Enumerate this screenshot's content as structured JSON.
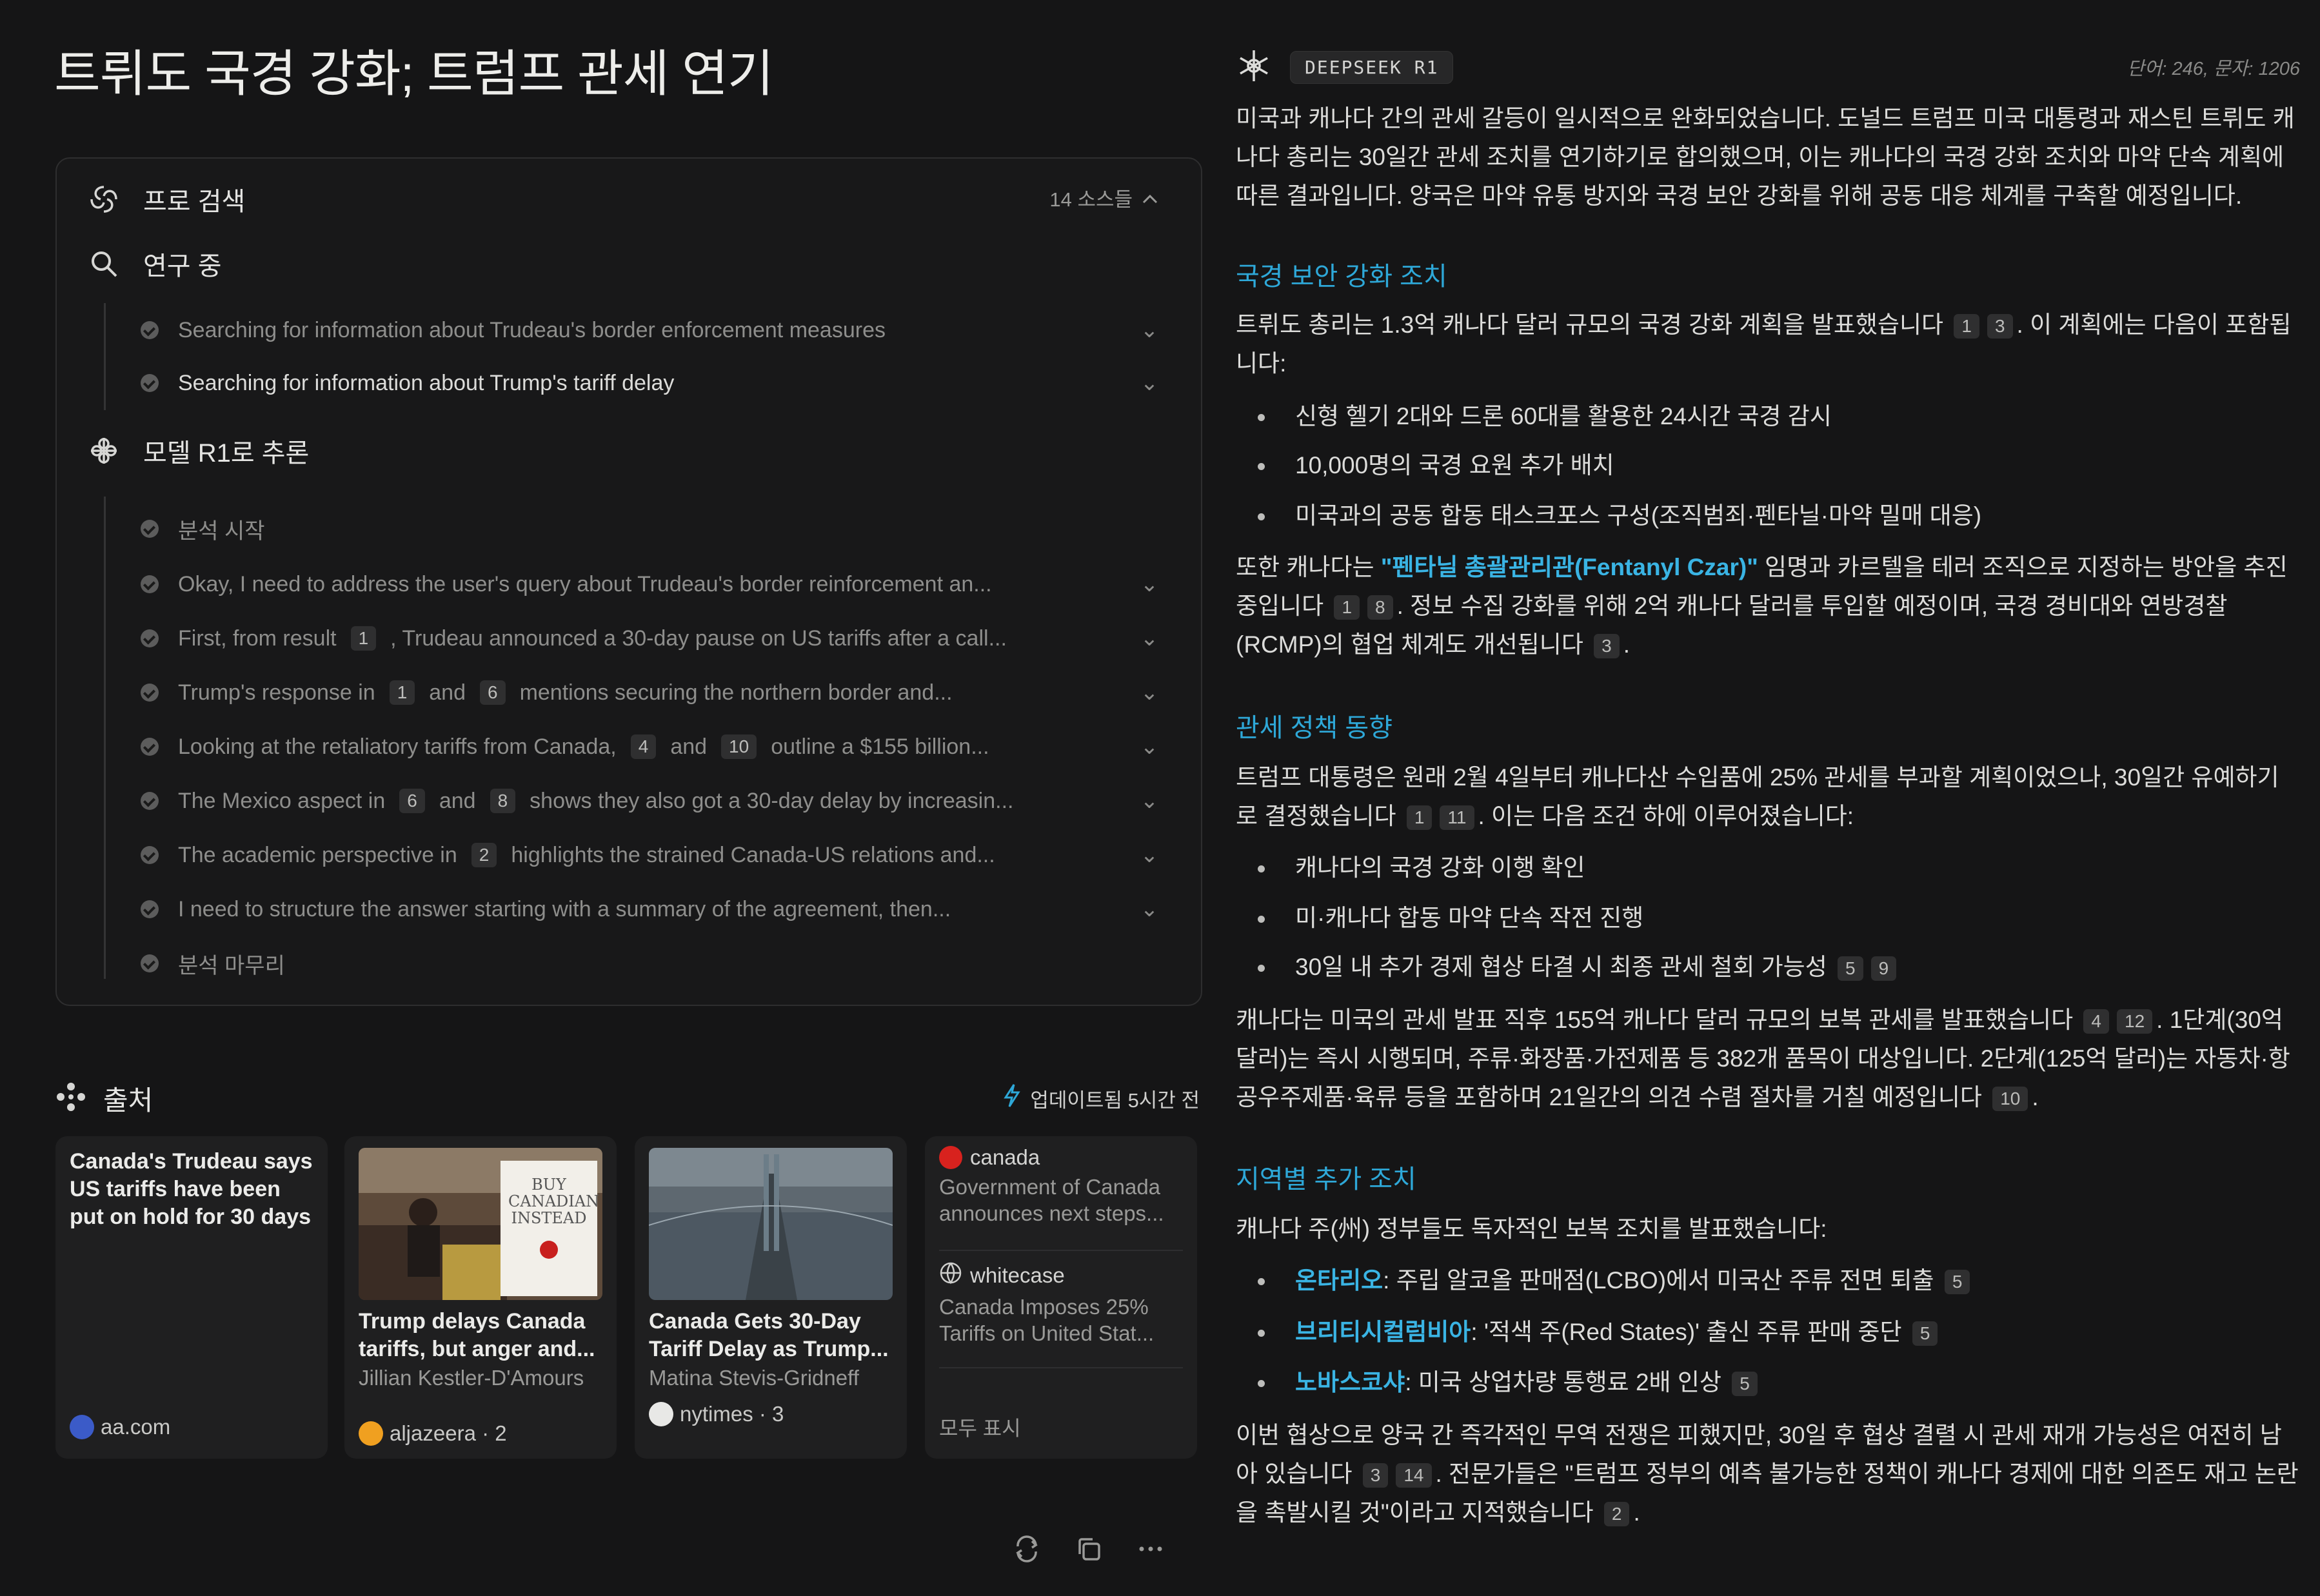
{
  "title": "트뤼도 국경 강화; 트럼프 관세 연기",
  "search": {
    "pro_label": "프로 검색",
    "source_count": "14 소스들",
    "research_label": "연구 중",
    "research_steps": [
      "Searching for information about Trudeau's border enforcement measures",
      "Searching for information about Trump's tariff delay"
    ],
    "reasoning_label": "모델 R1로 추론",
    "reasoning_steps": [
      {
        "parts": [
          "분석 시작"
        ]
      },
      {
        "parts": [
          "Okay, I need to address the user's query about Trudeau's border reinforcement an..."
        ]
      },
      {
        "parts": [
          "First, from result",
          "1",
          ", Trudeau announced a 30-day pause on US tariffs after a call..."
        ]
      },
      {
        "parts": [
          "Trump's response in",
          "1",
          "and",
          "6",
          "mentions securing the northern border and..."
        ]
      },
      {
        "parts": [
          "Looking at the retaliatory tariffs from Canada,",
          "4",
          "and",
          "10",
          "outline a $155 billion..."
        ]
      },
      {
        "parts": [
          "The Mexico aspect in",
          "6",
          "and",
          "8",
          "shows they also got a 30-day delay by increasin..."
        ]
      },
      {
        "parts": [
          "The academic perspective in",
          "2",
          "highlights the strained Canada-US relations and..."
        ]
      },
      {
        "parts": [
          "I need to structure the answer starting with a summary of the agreement, then..."
        ]
      },
      {
        "parts": [
          "분석 마무리"
        ]
      }
    ]
  },
  "sources": {
    "label": "출처",
    "updated": "업데이트됨 5시간 전",
    "cards": [
      {
        "title": "Canada's Trudeau says US tariffs have been put on hold for 30 days",
        "site": "aa.com"
      },
      {
        "title": "Trump delays Canada tariffs, but anger and...",
        "author": "Jillian Kestler-D'Amours",
        "site": "aljazeera · 2"
      },
      {
        "title": "Canada Gets 30-Day Tariff Delay as Trump...",
        "author": "Matina Stevis-Gridneff",
        "site": "nytimes · 3"
      }
    ],
    "minis": [
      {
        "site": "canada",
        "desc": "Government of Canada announces next steps..."
      },
      {
        "site": "whitecase",
        "desc": "Canada Imposes 25% Tariffs on United Stat..."
      }
    ],
    "show_all": "모두 표시",
    "thumb_sign": "BUY CANADIAN INSTEAD"
  },
  "answer": {
    "model_badge": "DEEPSEEK R1",
    "word_count": "단어: 246, 문자: 1206",
    "intro": "미국과 캐나다 간의 관세 갈등이 일시적으로 완화되었습니다. 도널드 트럼프 미국 대통령과 재스틴 트뤼도 캐나다 총리는 30일간 관세 조치를 연기하기로 합의했으며, 이는 캐나다의 국경 강화 조치와 마약 단속 계획에 따른 결과입니다. 양국은 마약 유통 방지와 국경 보안 강화를 위해 공동 대응 체계를 구축할 예정입니다.",
    "h_border": "국경 보안 강화 조치",
    "border_p1": "트뤼도 총리는 1.3억 캐나다 달러 규모의 국경 강화 계획을 발표했습니다",
    "border_p1_cites": [
      "1",
      "3"
    ],
    "border_p1_tail": ". 이 계획에는 다음이 포함됩니다:",
    "border_bullets": [
      "신형 헬기 2대와 드론 60대를 활용한 24시간 국경 감시",
      "10,000명의 국경 요원 추가 배치",
      "미국과의 공동 합동 태스크포스 구성(조직범죄·펜타닐·마약 밀매 대응)"
    ],
    "border_p2_a": "또한 캐나다는 ",
    "border_p2_link": "\"펜타닐 총괄관리관(Fentanyl Czar)\"",
    "border_p2_b": " 임명과 카르텔을 테러 조직으로 지정하는 방안을 추진 중입니다",
    "border_p2_cites": [
      "1",
      "8"
    ],
    "border_p2_c": ". 정보 수집 강화를 위해 2억 캐나다 달러를 투입할 예정이며, 국경 경비대와 연방경찰(RCMP)의 협업 체계도 개선됩니다",
    "border_p2_cite2": "3",
    "h_tariff": "관세 정책 동향",
    "tariff_p1": "트럼프 대통령은 원래 2월 4일부터 캐나다산 수입품에 25% 관세를 부과할 계획이었으나, 30일간 유예하기로 결정했습니다",
    "tariff_p1_cites": [
      "1",
      "11"
    ],
    "tariff_p1_tail": ". 이는 다음 조건 하에 이루어졌습니다:",
    "tariff_bullets": [
      "캐나다의 국경 강화 이행 확인",
      "미·캐나다 합동 마약 단속 작전 진행",
      "30일 내 추가 경제 협상 타결 시 최종 관세 철회 가능성"
    ],
    "tariff_bullet3_cites": [
      "5",
      "9"
    ],
    "tariff_p2": "캐나다는 미국의 관세 발표 직후 155억 캐나다 달러 규모의 보복 관세를 발표했습니다",
    "tariff_p2_cites": [
      "4",
      "12"
    ],
    "tariff_p2_tail": ". 1단계(30억 달러)는 즉시 시행되며, 주류·화장품·가전제품 등 382개 품목이 대상입니다. 2단계(125억 달러)는 자동차·항공우주제품·육류 등을 포함하며 21일간의 의견 수렴 절차를 거칠 예정입니다",
    "tariff_p2_cite2": "10",
    "h_region": "지역별 추가 조치",
    "region_intro": "캐나다 주(州) 정부들도 독자적인 보복 조치를 발표했습니다:",
    "region_bullets": [
      {
        "name": "온타리오",
        "text": ": 주립 알코올 판매점(LCBO)에서 미국산 주류 전면 퇴출",
        "cite": "5"
      },
      {
        "name": "브리티시컬럼비아",
        "text": ": '적색 주(Red States)' 출신 주류 판매 중단",
        "cite": "5"
      },
      {
        "name": "노바스코샤",
        "text": ": 미국 상업차량 통행료 2배 인상",
        "cite": "5"
      }
    ],
    "closing": "이번 협상으로 양국 간 즉각적인 무역 전쟁은 피했지만, 30일 후 협상 결렬 시 관세 재개 가능성은 여전히 남아 있습니다",
    "closing_cites": [
      "3",
      "14"
    ],
    "closing_b": ". 전문가들은 \"트럼프 정부의 예측 불가능한 정책이 캐나다 경제에 대한 의존도 재고 논란을 촉발시킬 것\"이라고 지적했습니다",
    "closing_cite2": "2"
  }
}
